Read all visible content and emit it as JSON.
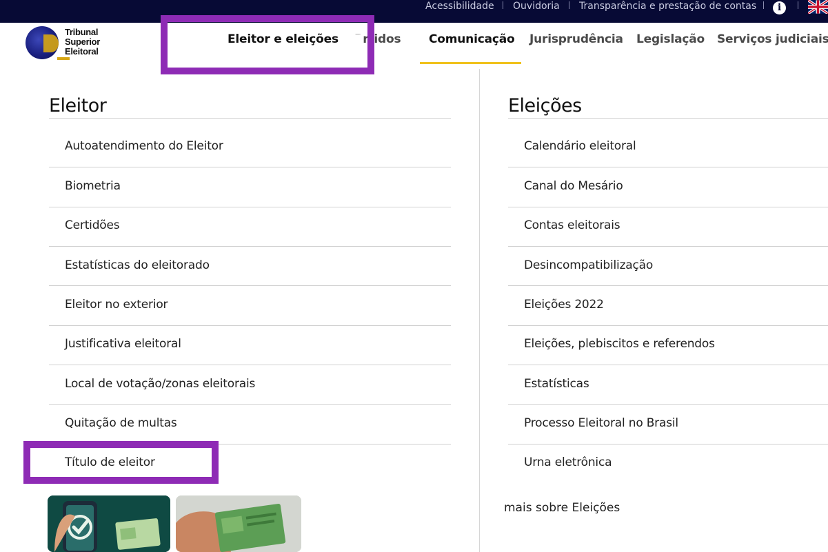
{
  "topbar": {
    "links": [
      "Acessibilidade",
      "Ouvidoria",
      "Transparência e prestação de contas"
    ],
    "info_icon": "info-icon",
    "language_icon": "uk-flag-icon"
  },
  "logo": {
    "lines": [
      "Tribunal",
      "Superior",
      "Eleitoral"
    ]
  },
  "nav": {
    "items": [
      "Eleitor e eleições",
      "Partidos",
      "Comunicação",
      "Jurisprudência",
      "Legislação",
      "Serviços judiciais"
    ],
    "partial_partidos": "rtidos",
    "active_item": "Comunicação"
  },
  "eleitor": {
    "title": "Eleitor",
    "items": [
      "Autoatendimento do Eleitor",
      "Biometria",
      "Certidões",
      "Estatísticas do eleitorado",
      "Eleitor no exterior",
      "Justificativa eleitoral",
      "Local de votação/zonas eleitorais",
      "Quitação de multas",
      "Título de eleitor"
    ]
  },
  "eleicoes": {
    "title": "Eleições",
    "items": [
      "Calendário eleitoral",
      "Canal do Mesário",
      "Contas eleitorais",
      "Desincompatibilização",
      "Eleições 2022",
      "Eleições, plebiscitos e referendos",
      "Estatísticas",
      "Processo Eleitoral no Brasil",
      "Urna eletrônica"
    ],
    "more_link": "mais sobre Eleições"
  },
  "colors": {
    "topbar_bg": "#070a35",
    "highlight": "#8e2bb5",
    "active_underline": "#f0c21c"
  }
}
